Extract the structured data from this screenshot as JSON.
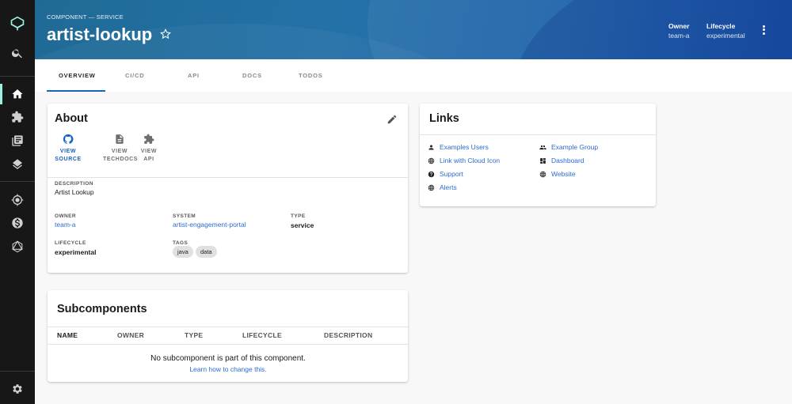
{
  "header": {
    "kind": "COMPONENT — SERVICE",
    "title": "artist-lookup",
    "owner_label": "Owner",
    "owner_value": "team-a",
    "lifecycle_label": "Lifecycle",
    "lifecycle_value": "experimental"
  },
  "tabs": [
    {
      "label": "OVERVIEW",
      "active": true
    },
    {
      "label": "CI/CD",
      "active": false
    },
    {
      "label": "API",
      "active": false
    },
    {
      "label": "DOCS",
      "active": false
    },
    {
      "label": "TODOS",
      "active": false
    }
  ],
  "sidebar": {
    "items": [
      "logo-icon",
      "search-icon",
      "home-icon",
      "puzzle-icon",
      "library-icon",
      "layers-icon",
      "target-icon",
      "dollar-icon",
      "graphql-icon",
      "settings-icon"
    ],
    "active_color": "#9BF0E1"
  },
  "about": {
    "title": "About",
    "buttons": [
      {
        "line1": "VIEW",
        "line2": "SOURCE",
        "icon": "github-icon"
      },
      {
        "line1": "VIEW",
        "line2": "TECHDOCS",
        "icon": "doc-icon"
      },
      {
        "line1": "VIEW",
        "line2": "API",
        "icon": "puzzle-icon"
      }
    ],
    "description_label": "DESCRIPTION",
    "description": "Artist Lookup",
    "owner_label": "OWNER",
    "owner": "team-a",
    "system_label": "SYSTEM",
    "system": "artist-engagement-portal",
    "type_label": "TYPE",
    "type": "service",
    "lifecycle_label": "LIFECYCLE",
    "lifecycle": "experimental",
    "tags_label": "TAGS",
    "tags": [
      "java",
      "data"
    ]
  },
  "links": {
    "title": "Links",
    "items": [
      {
        "label": "Examples Users",
        "icon": "person-icon"
      },
      {
        "label": "Example Group",
        "icon": "group-icon"
      },
      {
        "label": "Link with Cloud Icon",
        "icon": "globe-icon"
      },
      {
        "label": "Dashboard",
        "icon": "dashboard-icon"
      },
      {
        "label": "Support",
        "icon": "help-icon"
      },
      {
        "label": "Website",
        "icon": "globe-icon"
      },
      {
        "label": "Alerts",
        "icon": "globe-icon"
      }
    ]
  },
  "subcomponents": {
    "title": "Subcomponents",
    "columns": [
      "NAME",
      "OWNER",
      "TYPE",
      "LIFECYCLE",
      "DESCRIPTION"
    ],
    "empty_message": "No subcomponent is part of this component.",
    "empty_link": "Learn how to change this."
  },
  "colors": {
    "primary": "#1565c0",
    "link": "#2b6bd1",
    "sidebar_bg": "#171717"
  }
}
